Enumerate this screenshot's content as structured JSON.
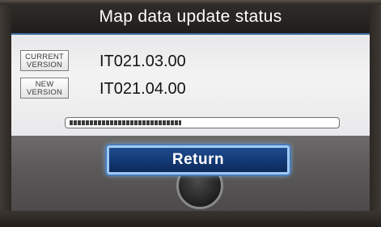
{
  "window": {
    "title": "Map data update status"
  },
  "versions": {
    "current": {
      "tag_line1": "CURRENT",
      "tag_line2": "VERSION",
      "value": "IT021.03.00"
    },
    "new": {
      "tag_line1": "NEW",
      "tag_line2": "VERSION",
      "value": "IT021.04.00"
    }
  },
  "progress": {
    "fraction": 0.42
  },
  "actions": {
    "return_label": "Return"
  },
  "colors": {
    "accent": "#143a76",
    "button_glow": "#9ecaf2",
    "title_bar": "#262321"
  }
}
